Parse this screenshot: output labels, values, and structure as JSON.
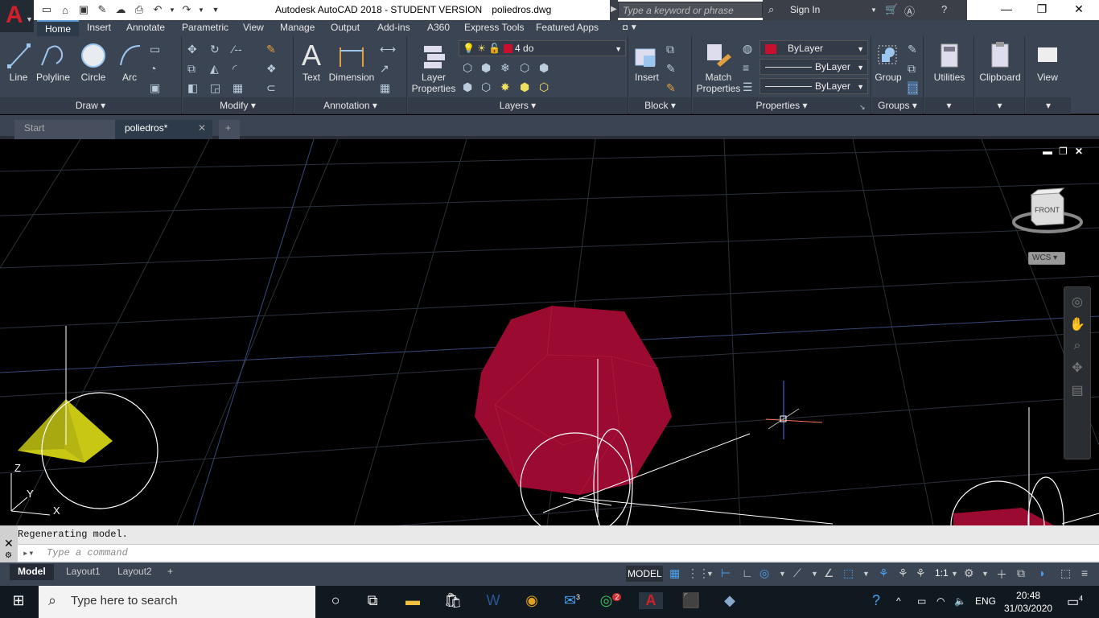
{
  "title": {
    "app": "Autodesk AutoCAD 2018 - STUDENT VERSION",
    "doc": "poliedros.dwg",
    "search_placeholder": "Type a keyword or phrase",
    "sign_in": "Sign In"
  },
  "ribbon_tabs": [
    "Home",
    "Insert",
    "Annotate",
    "Parametric",
    "View",
    "Manage",
    "Output",
    "Add-ins",
    "A360",
    "Express Tools",
    "Featured Apps"
  ],
  "draw": {
    "line": "Line",
    "polyline": "Polyline",
    "circle": "Circle",
    "arc": "Arc",
    "title": "Draw"
  },
  "modify": {
    "title": "Modify"
  },
  "annotation": {
    "text": "Text",
    "dimension": "Dimension",
    "title": "Annotation"
  },
  "layers": {
    "properties_1": "Layer",
    "properties_2": "Properties",
    "current": "4 do",
    "title": "Layers"
  },
  "block": {
    "insert": "Insert",
    "title": "Block"
  },
  "properties": {
    "match_1": "Match",
    "match_2": "Properties",
    "color": "ByLayer",
    "linetype": "ByLayer",
    "lineweight": "ByLayer",
    "title": "Properties",
    "color_swatch": "#c8102e"
  },
  "groups": {
    "group": "Group",
    "title": "Groups"
  },
  "utilities": "Utilities",
  "clipboard": "Clipboard",
  "view": "View",
  "doc_tabs": {
    "start": "Start",
    "active": "poliedros*"
  },
  "viewcube": {
    "face": "FRONT",
    "wcs": "WCS"
  },
  "ucs": {
    "z": "Z",
    "y": "Y",
    "x": "X"
  },
  "command": {
    "history": "Regenerating model.",
    "placeholder": "Type a command"
  },
  "layout_tabs": [
    "Model",
    "Layout1",
    "Layout2"
  ],
  "status": {
    "model": "MODEL",
    "scale": "1:1"
  },
  "taskbar": {
    "search": "Type here to search",
    "lang": "ENG",
    "time": "20:48",
    "date": "31/03/2020",
    "notifications": "4",
    "mail_badge": "3",
    "whatsapp_badge": "2"
  },
  "colors": {
    "solid_red": "#9b0a30",
    "pyramid_yellow": "#c8c814"
  }
}
